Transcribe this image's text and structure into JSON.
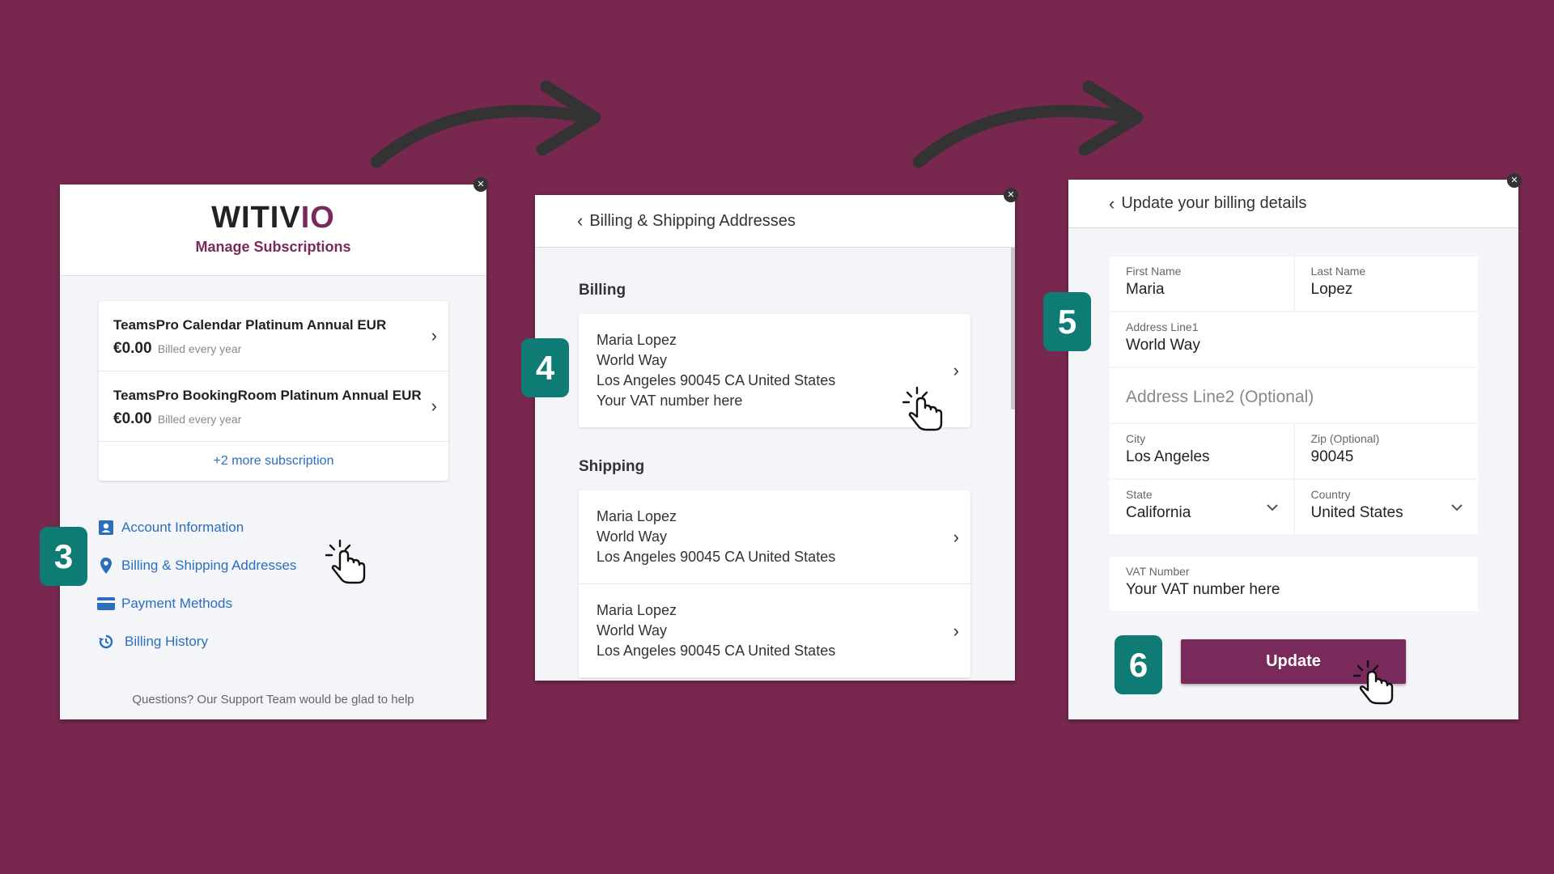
{
  "colors": {
    "background": "#78284f",
    "brand": "#7a2a5a",
    "link": "#2a6ebd",
    "badge": "#0e7b75"
  },
  "steps": [
    "3",
    "4",
    "5",
    "6"
  ],
  "panel1": {
    "logo_main": "WITIV",
    "logo_accent": "IO",
    "subtitle": "Manage Subscriptions",
    "subscriptions": [
      {
        "name": "TeamsPro Calendar Platinum Annual EUR",
        "price": "€0.00",
        "billed": "Billed every year"
      },
      {
        "name": "TeamsPro BookingRoom Platinum Annual EUR",
        "price": "€0.00",
        "billed": "Billed every year"
      }
    ],
    "more": "+2 more subscription",
    "menu": [
      {
        "label": "Account Information",
        "icon": "account-icon"
      },
      {
        "label": "Billing & Shipping Addresses",
        "icon": "location-pin-icon"
      },
      {
        "label": "Payment Methods",
        "icon": "credit-card-icon"
      },
      {
        "label": "Billing History",
        "icon": "history-icon"
      }
    ],
    "support": "Questions? Our Support Team would be glad to help"
  },
  "panel2": {
    "title": "Billing & Shipping Addresses",
    "billing_label": "Billing",
    "billing": {
      "line1": "Maria Lopez",
      "line2": "World Way",
      "line3": "Los Angeles 90045 CA United States",
      "line4": "Your VAT number here"
    },
    "shipping_label": "Shipping",
    "shipping": [
      {
        "line1": "Maria Lopez",
        "line2": "World Way",
        "line3": "Los Angeles 90045 CA United States"
      },
      {
        "line1": "Maria Lopez",
        "line2": "World Way",
        "line3": "Los Angeles 90045 CA United States"
      }
    ]
  },
  "panel3": {
    "title": "Update your billing details",
    "first_name_label": "First Name",
    "first_name": "Maria",
    "last_name_label": "Last Name",
    "last_name": "Lopez",
    "address1_label": "Address Line1",
    "address1": "World Way",
    "address2_placeholder": "Address Line2 (Optional)",
    "city_label": "City",
    "city": "Los Angeles",
    "zip_label": "Zip (Optional)",
    "zip": "90045",
    "state_label": "State",
    "state": "California",
    "country_label": "Country",
    "country": "United States",
    "vat_label": "VAT Number",
    "vat": "Your VAT number here",
    "update_button": "Update"
  }
}
